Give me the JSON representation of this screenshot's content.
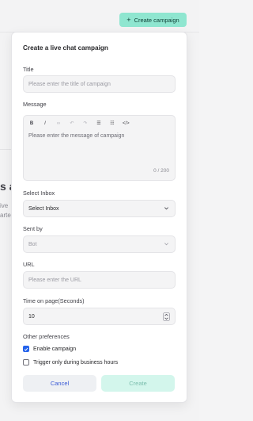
{
  "header": {
    "create_button_label": "Create campaign"
  },
  "background": {
    "fragment_title": "s a",
    "fragment_line1": "ive",
    "fragment_line2": "arte"
  },
  "form": {
    "title": "Create a live chat campaign",
    "title_field": {
      "label": "Title",
      "placeholder": "Please enter the title of campaign"
    },
    "message_field": {
      "label": "Message",
      "placeholder": "Please enter the message of campaign",
      "counter": "0 / 200"
    },
    "toolbar": {
      "bold": "B",
      "italic": "I",
      "link": "∞",
      "undo": "↶",
      "redo": "↷",
      "bullet_list": "☰",
      "ordered_list": "☷",
      "code": "</>"
    },
    "inbox_field": {
      "label": "Select Inbox",
      "value": "Select Inbox"
    },
    "sent_by_field": {
      "label": "Sent by",
      "value": "Bot"
    },
    "url_field": {
      "label": "URL",
      "placeholder": "Please enter the URL"
    },
    "time_field": {
      "label": "Time on page(Seconds)",
      "value": "10"
    },
    "preferences": {
      "label": "Other preferences",
      "enable_campaign": {
        "label": "Enable campaign",
        "checked": true
      },
      "business_hours": {
        "label": "Trigger only during business hours",
        "checked": false
      }
    },
    "cancel_label": "Cancel",
    "create_label": "Create"
  },
  "colors": {
    "accent": "#8fe6d0",
    "checkbox_checked": "#2563eb",
    "cancel_text": "#3b5bd6"
  },
  "icons": [
    "plus-icon",
    "chevron-down-icon",
    "stepper-icon",
    "check-icon"
  ]
}
